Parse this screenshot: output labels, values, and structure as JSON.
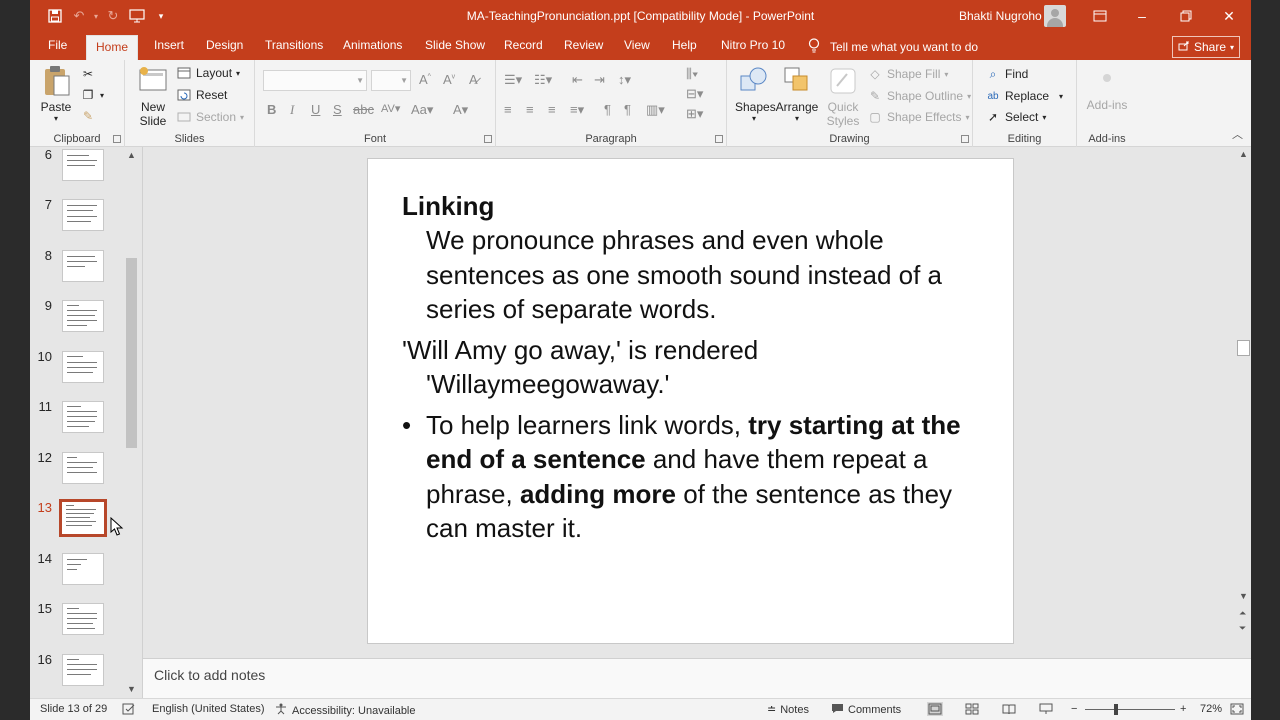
{
  "titlebar": {
    "doc_title": "MA-TeachingPronunciation.ppt [Compatibility Mode]  -  PowerPoint",
    "user_name": "Bhakti Nugroho"
  },
  "tabs": [
    {
      "label": "File"
    },
    {
      "label": "Home"
    },
    {
      "label": "Insert"
    },
    {
      "label": "Design"
    },
    {
      "label": "Transitions"
    },
    {
      "label": "Animations"
    },
    {
      "label": "Slide Show"
    },
    {
      "label": "Record"
    },
    {
      "label": "Review"
    },
    {
      "label": "View"
    },
    {
      "label": "Help"
    },
    {
      "label": "Nitro Pro 10"
    }
  ],
  "tell_me": "Tell me what you want to do",
  "share_label": "Share",
  "ribbon": {
    "clipboard": {
      "label": "Clipboard",
      "paste": "Paste"
    },
    "slides": {
      "label": "Slides",
      "new_slide_1": "New",
      "new_slide_2": "Slide",
      "layout": "Layout",
      "reset": "Reset",
      "section": "Section"
    },
    "font": {
      "label": "Font"
    },
    "paragraph": {
      "label": "Paragraph"
    },
    "drawing": {
      "label": "Drawing",
      "shapes": "Shapes",
      "arrange": "Arrange",
      "quick_styles_1": "Quick",
      "quick_styles_2": "Styles",
      "shape_fill": "Shape Fill",
      "shape_outline": "Shape Outline",
      "shape_effects": "Shape Effects"
    },
    "editing": {
      "label": "Editing",
      "find": "Find",
      "replace": "Replace",
      "select": "Select"
    },
    "addins": {
      "label": "Add-ins",
      "addins_btn": "Add-ins"
    }
  },
  "thumbnails": [
    {
      "num": "6"
    },
    {
      "num": "7"
    },
    {
      "num": "8"
    },
    {
      "num": "9"
    },
    {
      "num": "10"
    },
    {
      "num": "11"
    },
    {
      "num": "12"
    },
    {
      "num": "13"
    },
    {
      "num": "14"
    },
    {
      "num": "15"
    },
    {
      "num": "16"
    }
  ],
  "slide": {
    "title": "Linking",
    "p1": "We pronounce phrases and even whole sentences as one smooth sound instead of a series of separate words.",
    "p2": "'Will Amy go away,' is rendered 'Willaymeegowaway.'",
    "bullet_char": "•",
    "b_text1": "To help learners link words, ",
    "b_bold1": "try starting at the end of a sentence",
    "b_text2": " and have them repeat a phrase, ",
    "b_bold2": "adding more",
    "b_text3": " of the sentence as they can master it."
  },
  "notes_placeholder": "Click to add notes",
  "statusbar": {
    "slide_info": "Slide 13 of 29",
    "language": "English (United States)",
    "accessibility": "Accessibility: Unavailable",
    "notes": "Notes",
    "comments": "Comments",
    "zoom": "72%"
  },
  "colors": {
    "accent": "#c43e1c",
    "selected_thumb_border": "#b7472a"
  }
}
